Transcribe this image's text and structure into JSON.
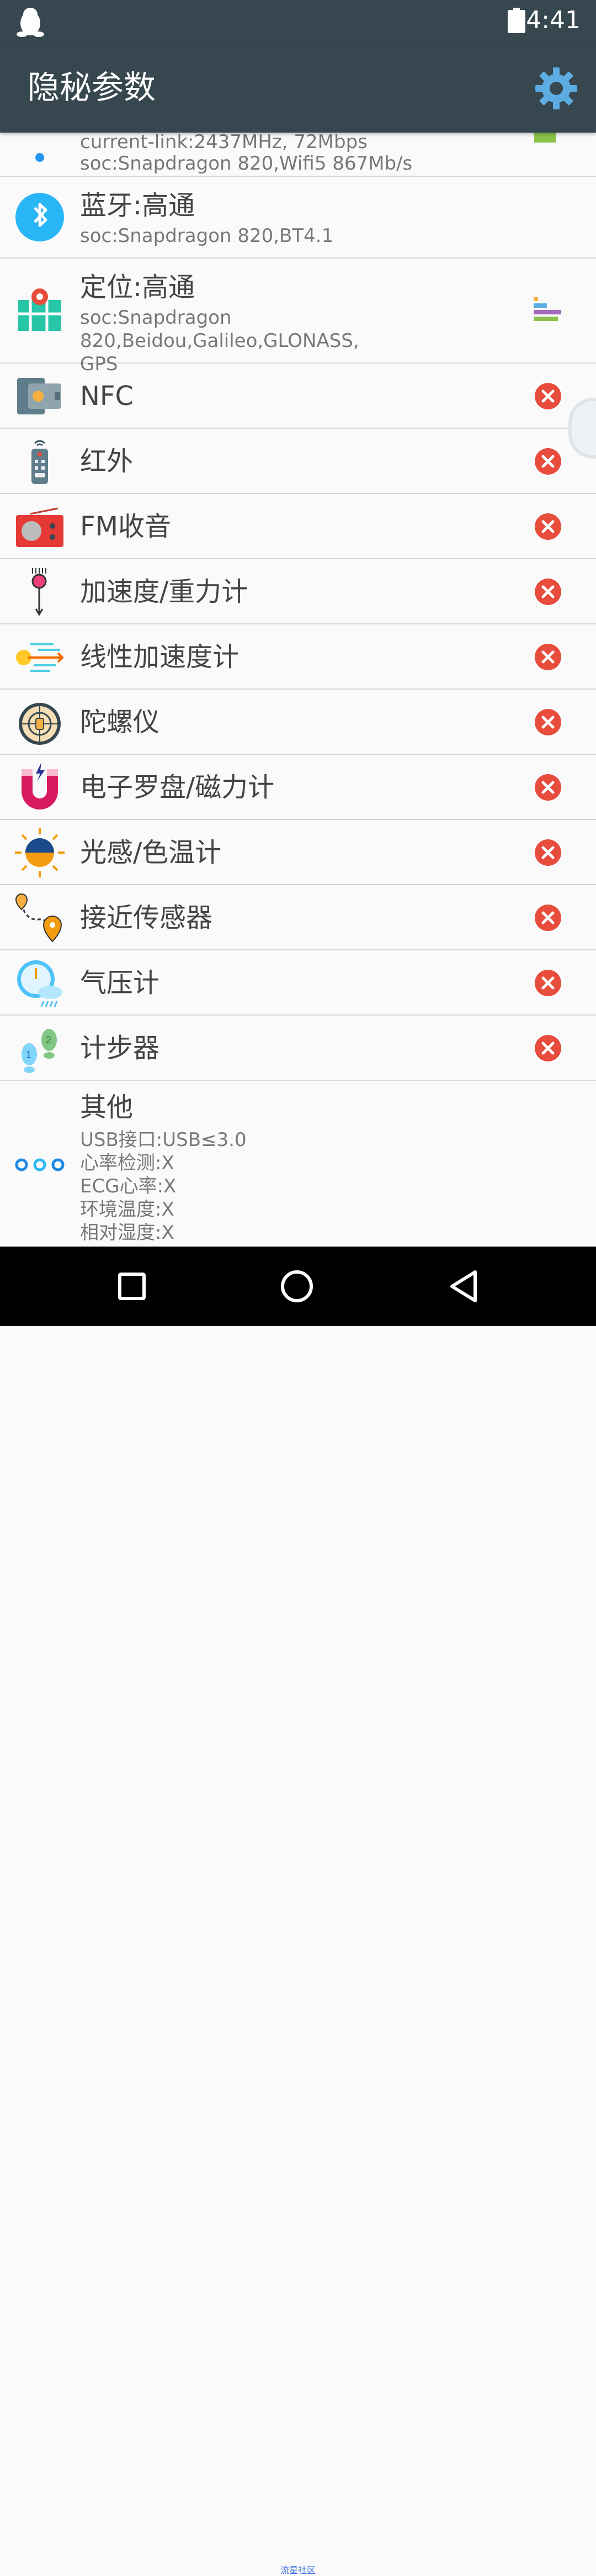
{
  "status_bar": {
    "time": "4:41",
    "app_icon": "qq-penguin-icon",
    "battery_icon": "battery-full-icon"
  },
  "app_bar": {
    "title": "隐秘参数",
    "action_icon": "gear-icon"
  },
  "list": {
    "wifi": {
      "subtitle_partial": "current-link:2437MHz, 72Mbps",
      "subtitle": "soc:Snapdragon 820,Wifi5 867Mb/s"
    },
    "bluetooth": {
      "title": "蓝牙:高通",
      "subtitle": "soc:Snapdragon 820,BT4.1"
    },
    "location": {
      "title": "定位:高通",
      "subtitle": "soc:Snapdragon 820,Beidou,Galileo,GLONASS,\nGPS"
    },
    "nfc": {
      "title": "NFC"
    },
    "infrared": {
      "title": "红外"
    },
    "fm": {
      "title": "FM收音"
    },
    "accelerometer": {
      "title": "加速度/重力计"
    },
    "linear_accel": {
      "title": "线性加速度计"
    },
    "gyroscope": {
      "title": "陀螺仪"
    },
    "compass": {
      "title": "电子罗盘/磁力计"
    },
    "light": {
      "title": "光感/色温计"
    },
    "proximity": {
      "title": "接近传感器"
    },
    "barometer": {
      "title": "气压计"
    },
    "pedometer": {
      "title": "计步器"
    },
    "other": {
      "title": "其他",
      "lines": "USB接口:USB≤3.0\n心率检测:X\nECG心率:X\n环境温度:X\n相对湿度:X"
    }
  },
  "colors": {
    "appbar": "#37474f",
    "unsupported": "#e74c3c",
    "divider": "#d8d8d8"
  },
  "watermark": "流星社区"
}
